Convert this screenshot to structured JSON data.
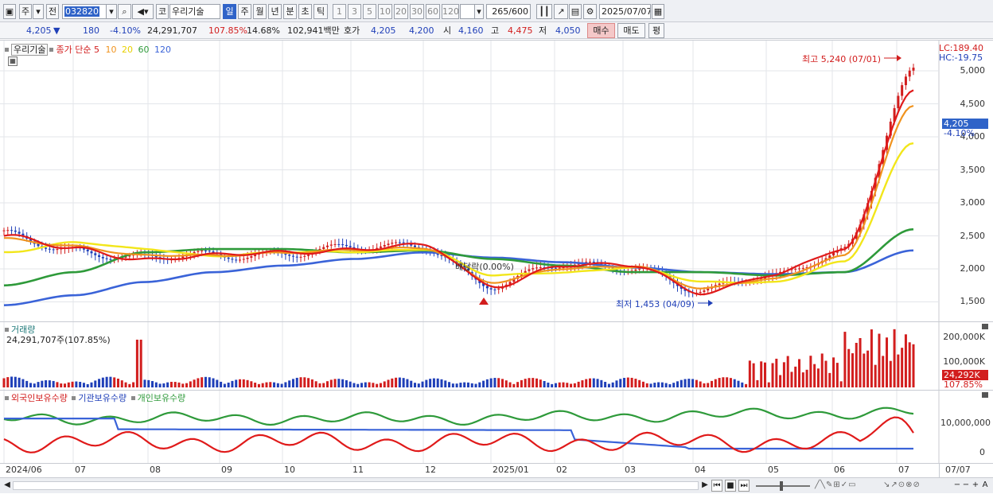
{
  "toolbar": {
    "market": "주",
    "prev": "전",
    "code": "032820",
    "cat": "코",
    "name": "우리기술",
    "periods": [
      "일",
      "주",
      "월",
      "년",
      "분",
      "초",
      "틱"
    ],
    "minutes": [
      "1",
      "3",
      "5",
      "10",
      "20",
      "30",
      "60",
      "120"
    ],
    "count": "265",
    "count_total": "/600",
    "date": "2025/07/07"
  },
  "quote": {
    "price": "4,205",
    "change": "180",
    "change_pct": "-4.10%",
    "volume": "24,291,707",
    "volume_pct": "107.85%",
    "turnover": "14.68%",
    "amount": "102,941백만",
    "bid_label": "호가",
    "ask_price": "4,205",
    "bid_price": "4,200",
    "open_label": "시",
    "open": "4,160",
    "high_label": "고",
    "high": "4,475",
    "low_label": "저",
    "low": "4,050",
    "buy": "매수",
    "sell": "매도",
    "eval": "평"
  },
  "price_pane": {
    "stock_name": "우리기술",
    "ma_label": "종가 단순 5",
    "ma": [
      "10",
      "20",
      "60",
      "120"
    ],
    "lc": "LC:189.40",
    "hc": "HC:-19.75",
    "y_ticks": [
      "5,000",
      "4,500",
      "4,000",
      "3,500",
      "3,000",
      "2,500",
      "2,000",
      "1,500"
    ],
    "current_marker": "4,205",
    "current_pct": "-4.10%",
    "high_annot": "최고 5,240 (07/01)",
    "low_annot": "최저 1,453 (04/09)",
    "div_annot": "배당락(0.00%)"
  },
  "volume_pane": {
    "title": "거래량",
    "info": "24,291,707주(107.85%)",
    "y_ticks": [
      "200,000K",
      "100,000K"
    ],
    "marker": "24,292K",
    "marker_pct": "107.85%"
  },
  "holder_pane": {
    "labels": [
      "외국인보유수량",
      "기관보유수량",
      "개인보유수량"
    ],
    "y_ticks": [
      "10,000,000",
      "0"
    ]
  },
  "x_labels": [
    "2024/06",
    "07",
    "08",
    "09",
    "10",
    "11",
    "12",
    "2025/01",
    "02",
    "03",
    "04",
    "05",
    "06",
    "07"
  ],
  "x_right": "07/07",
  "colors": {
    "up": "#d21d1d",
    "down": "#1f3fb8",
    "ma5": "#e01a1a",
    "ma10": "#f0931e",
    "ma20": "#f2e61a",
    "ma60": "#2e9a3a",
    "ma120": "#3a63d8",
    "accent": "#2f63c8"
  },
  "chart_data": {
    "type": "line",
    "title": "",
    "xlabel": "",
    "ylabel": "",
    "categories": [
      "2024/06",
      "07",
      "08",
      "09",
      "10",
      "11",
      "12",
      "2025/01",
      "02",
      "03",
      "04",
      "05",
      "06",
      "07"
    ],
    "ylim": [
      1300,
      5300
    ],
    "series": [
      {
        "name": "5",
        "values": [
          2500,
          2300,
          2150,
          2200,
          2250,
          2300,
          2350,
          1750,
          2050,
          2050,
          1650,
          1900,
          2300,
          4700
        ]
      },
      {
        "name": "10",
        "values": [
          2450,
          2350,
          2200,
          2200,
          2250,
          2280,
          2320,
          1800,
          2000,
          2050,
          1700,
          1850,
          2200,
          4450
        ]
      },
      {
        "name": "20",
        "values": [
          2250,
          2400,
          2300,
          2200,
          2250,
          2260,
          2300,
          1900,
          1950,
          2020,
          1800,
          1800,
          2100,
          3900
        ]
      },
      {
        "name": "60",
        "values": [
          1750,
          1950,
          2250,
          2300,
          2300,
          2250,
          2280,
          2150,
          2050,
          1950,
          1950,
          1900,
          1950,
          2600
        ]
      },
      {
        "name": "120",
        "values": [
          1450,
          1600,
          1800,
          1950,
          2050,
          2150,
          2250,
          2170,
          2100,
          2020,
          1950,
          1920,
          1950,
          2280
        ]
      }
    ],
    "extrema": {
      "high": 5240,
      "high_date": "07/01",
      "low": 1453,
      "low_date": "04/09"
    }
  }
}
